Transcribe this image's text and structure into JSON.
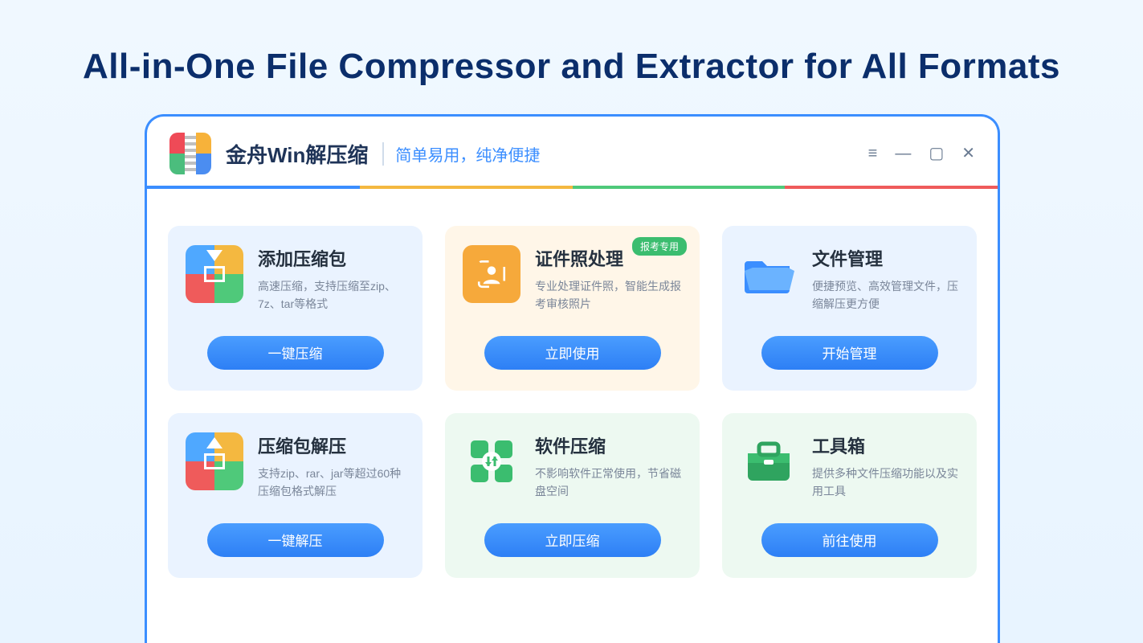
{
  "page": {
    "headline": "All-in-One File Compressor and Extractor for All Formats"
  },
  "window": {
    "app_name": "金舟Win解压缩",
    "tagline": "简单易用，纯净便捷",
    "controls": {
      "menu": "≡",
      "min": "—",
      "max": "▢",
      "close": "✕"
    }
  },
  "cards": [
    {
      "id": "add-archive",
      "title": "添加压缩包",
      "desc": "高速压缩，支持压缩至zip、7z、tar等格式",
      "button": "一键压缩",
      "bg": "blue",
      "icon": "compress"
    },
    {
      "id": "id-photo",
      "title": "证件照处理",
      "desc": "专业处理证件照，智能生成报考审核照片",
      "button": "立即使用",
      "badge": "报考专用",
      "bg": "orange",
      "icon": "photo"
    },
    {
      "id": "file-manager",
      "title": "文件管理",
      "desc": "便捷预览、高效管理文件，压缩解压更方便",
      "button": "开始管理",
      "bg": "blue",
      "icon": "folder"
    },
    {
      "id": "extract",
      "title": "压缩包解压",
      "desc": "支持zip、rar、jar等超过60种压缩包格式解压",
      "button": "一键解压",
      "bg": "blue",
      "icon": "extract"
    },
    {
      "id": "software-compress",
      "title": "软件压缩",
      "desc": "不影响软件正常使用，节省磁盘空间",
      "button": "立即压缩",
      "bg": "green",
      "icon": "soft"
    },
    {
      "id": "toolbox",
      "title": "工具箱",
      "desc": "提供多种文件压缩功能以及实用工具",
      "button": "前往使用",
      "bg": "green",
      "icon": "toolbox"
    }
  ]
}
